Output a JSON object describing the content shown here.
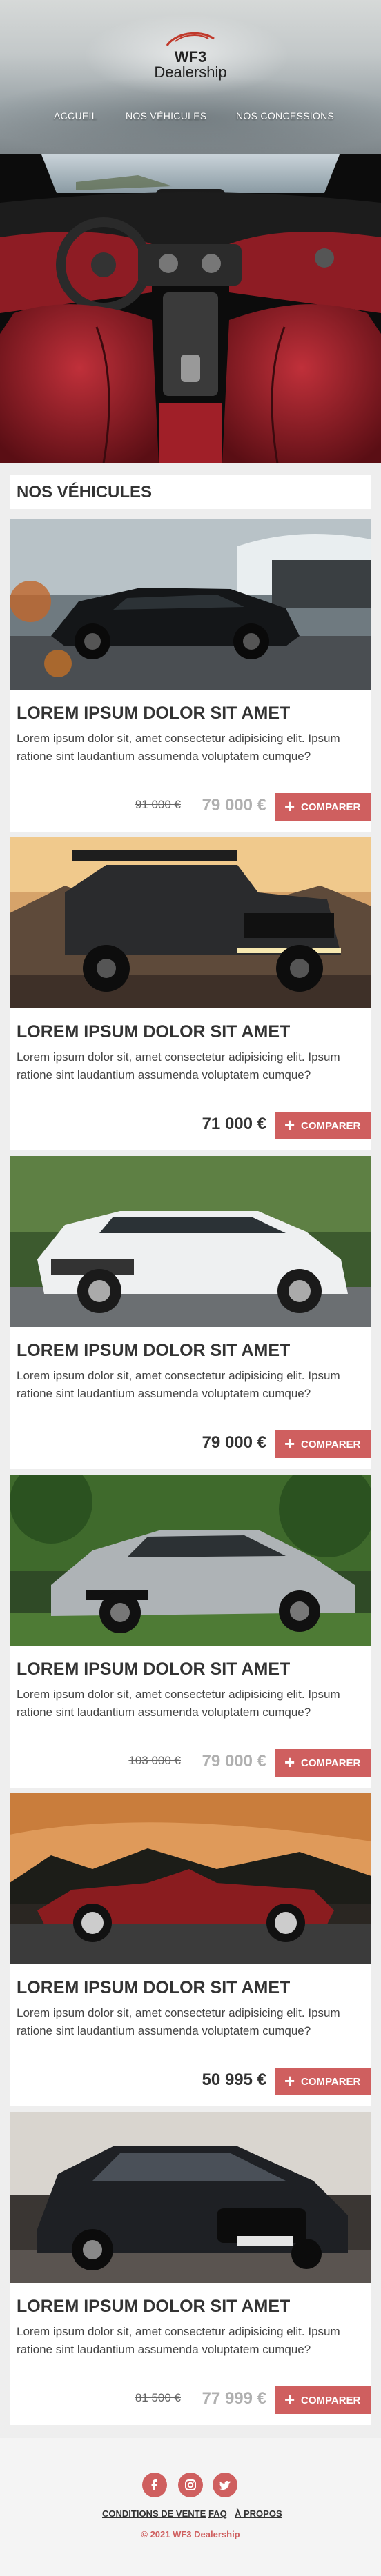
{
  "brand": {
    "line1": "WF3",
    "line2": "Dealership"
  },
  "nav": [
    {
      "label": "Accueil"
    },
    {
      "label": "Nos véhicules"
    },
    {
      "label": "Nos concessions"
    }
  ],
  "section_title": "Nos véhicules",
  "cards": [
    {
      "title": "LOREM IPSUM DOLOR SIT AMET",
      "text": "Lorem ipsum dolor sit, amet consectetur adipisicing elit. Ipsum ratione sint laudantium assumenda voluptatem cumque?",
      "old_price": "91 000 €",
      "price": "79 000 €",
      "price_color": "#b0b0b0",
      "button": "Comparer"
    },
    {
      "title": "LOREM IPSUM DOLOR SIT AMET",
      "text": "Lorem ipsum dolor sit, amet consectetur adipisicing elit. Ipsum ratione sint laudantium assumenda voluptatem cumque?",
      "old_price": "",
      "price": "71 000 €",
      "price_color": "#333333",
      "button": "Comparer"
    },
    {
      "title": "LOREM IPSUM DOLOR SIT AMET",
      "text": "Lorem ipsum dolor sit, amet consectetur adipisicing elit. Ipsum ratione sint laudantium assumenda voluptatem cumque?",
      "old_price": "",
      "price": "79 000 €",
      "price_color": "#333333",
      "button": "Comparer"
    },
    {
      "title": "LOREM IPSUM DOLOR SIT AMET",
      "text": "Lorem ipsum dolor sit, amet consectetur adipisicing elit. Ipsum ratione sint laudantium assumenda voluptatem cumque?",
      "old_price": "103 000 €",
      "price": "79 000 €",
      "price_color": "#b0b0b0",
      "button": "Comparer"
    },
    {
      "title": "LOREM IPSUM DOLOR SIT AMET",
      "text": "Lorem ipsum dolor sit, amet consectetur adipisicing elit. Ipsum ratione sint laudantium assumenda voluptatem cumque?",
      "old_price": "",
      "price": "50 995 €",
      "price_color": "#333333",
      "button": "Comparer"
    },
    {
      "title": "LOREM IPSUM DOLOR SIT AMET",
      "text": "Lorem ipsum dolor sit, amet consectetur adipisicing elit. Ipsum ratione sint laudantium assumenda voluptatem cumque?",
      "old_price": "81 500 €",
      "price": "77 999 €",
      "price_color": "#b0b0b0",
      "button": "Comparer"
    }
  ],
  "footer": {
    "social": [
      "facebook-icon",
      "instagram-icon",
      "twitter-icon"
    ],
    "links": [
      "Conditions de vente",
      "FAQ",
      "À propos"
    ],
    "copyright": "© 2021 WF3 Dealership"
  },
  "colors": {
    "accent": "#cf5f5f",
    "background": "#eeeeee"
  }
}
